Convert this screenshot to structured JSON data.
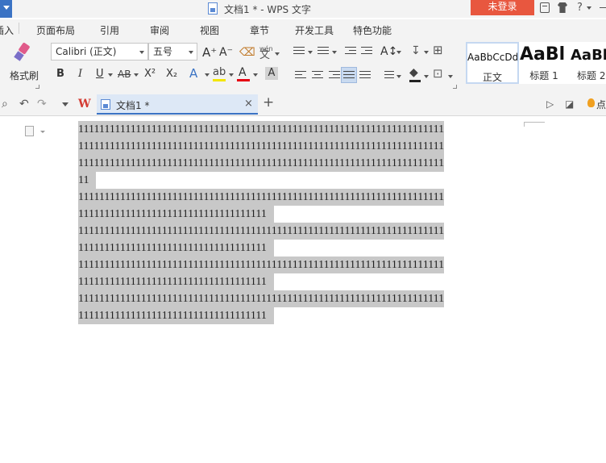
{
  "window": {
    "title": "文档1 * - WPS 文字",
    "login_label": "未登录",
    "help_label": "?"
  },
  "ribbon_tabs": [
    {
      "label": "插入"
    },
    {
      "label": "页面布局"
    },
    {
      "label": "引用"
    },
    {
      "label": "审阅"
    },
    {
      "label": "视图"
    },
    {
      "label": "章节"
    },
    {
      "label": "开发工具"
    },
    {
      "label": "特色功能"
    }
  ],
  "ribbon": {
    "format_painter_label": "格式刷",
    "font_name": "Calibri (正文)",
    "font_size": "五号",
    "bold": "B",
    "italic": "I",
    "underline": "U",
    "strikethrough": "AB",
    "superscript": "X²",
    "subscript": "X₂",
    "font_color_letter": "A",
    "wen_glyph": "文",
    "pinyin_glyph": "wén",
    "grow_font": "A⁺",
    "shrink_font": "A⁻",
    "char_shade_letter": "A",
    "colors": {
      "highlight": "#f3e600",
      "font_color": "#e60012",
      "accent": "#3b73c4",
      "login": "#e8573f"
    }
  },
  "styles": [
    {
      "sample": "AaBbCcDd",
      "name": "正文"
    },
    {
      "sample": "AaBl",
      "name": "标题 1"
    },
    {
      "sample": "AaBl",
      "name": "标题 2"
    }
  ],
  "quickbar": {
    "doc_tab_label": "文档1 *",
    "close_glyph": "×",
    "add_glyph": "+",
    "right_text": "点"
  },
  "document": {
    "lines": [
      "1111111111111111111111111111111111111111111111111111111111111111111111",
      "1111111111111111111111111111111111111111111111111111111111111111111111",
      "1111111111111111111111111111111111111111111111111111111111111111111111",
      "11",
      "1111111111111111111111111111111111111111111111111111111111111111111111",
      "111111111111111111111111111111111111",
      "1111111111111111111111111111111111111111111111111111111111111111111111",
      "111111111111111111111111111111111111",
      "1111111111111111111111111111111111111111111111111111111111111111111111",
      "111111111111111111111111111111111111",
      "1111111111111111111111111111111111111111111111111111111111111111111111",
      "111111111111111111111111111111111111"
    ]
  }
}
